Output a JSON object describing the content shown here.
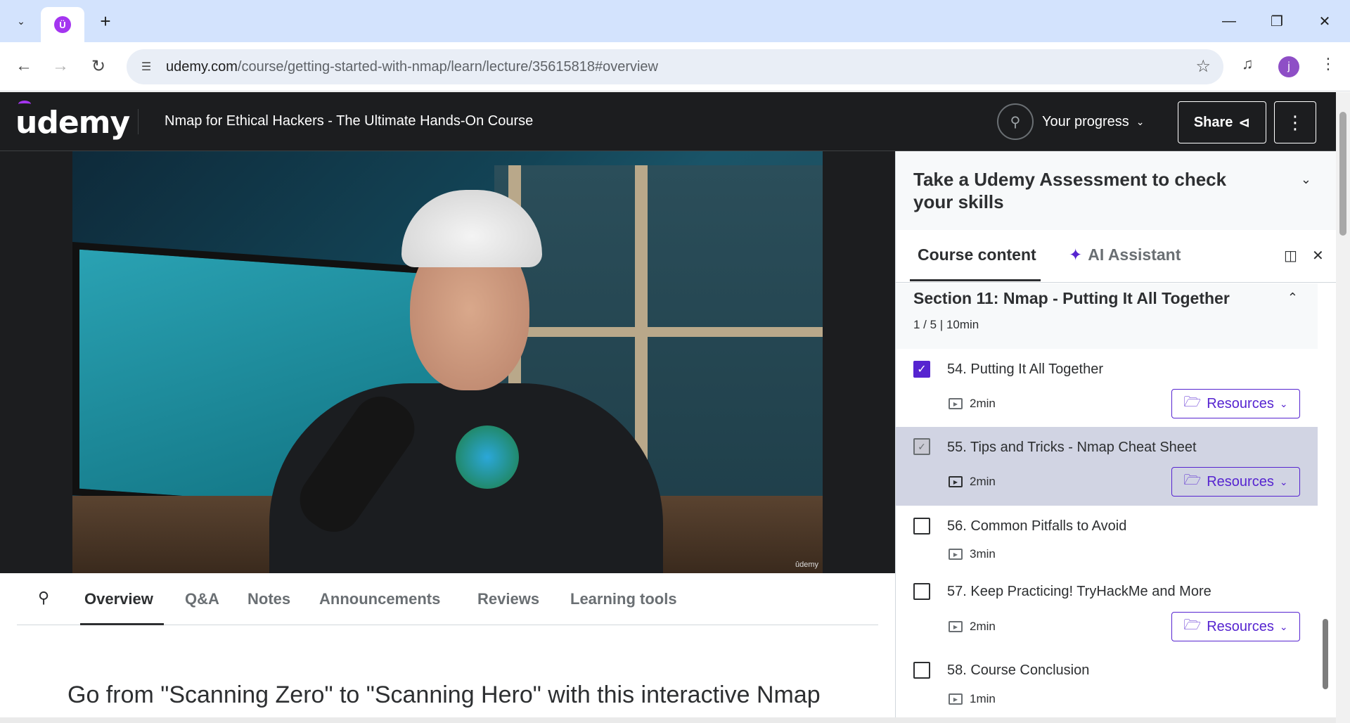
{
  "browser": {
    "url_host": "udemy.com",
    "url_path": "/course/getting-started-with-nmap/learn/lecture/35615818#overview"
  },
  "header": {
    "logo": "udemy",
    "course_title": "Nmap for Ethical Hackers - The Ultimate Hands-On Course",
    "progress_label": "Your progress",
    "share_label": "Share"
  },
  "video": {
    "watermark": "ûdemy"
  },
  "tabs": {
    "items": [
      "Overview",
      "Q&A",
      "Notes",
      "Announcements",
      "Reviews",
      "Learning tools"
    ],
    "active": "Overview"
  },
  "overview": {
    "headline": "Go from \"Scanning Zero\" to \"Scanning Hero\" with this interactive Nmap"
  },
  "sidebar": {
    "assessment": "Take a Udemy Assessment to check your skills",
    "tab_course": "Course content",
    "tab_ai": "AI Assistant",
    "section_title": "Section 11: Nmap - Putting It All Together",
    "section_meta": "1 / 5 | 10min",
    "lectures": [
      {
        "title": "54. Putting It All Together",
        "duration": "2min",
        "done": true,
        "resources": "Resources"
      },
      {
        "title": "55. Tips and Tricks - Nmap Cheat Sheet",
        "duration": "2min",
        "done": false,
        "resources": "Resources"
      },
      {
        "title": "56. Common Pitfalls to Avoid",
        "duration": "3min",
        "done": false
      },
      {
        "title": "57. Keep Practicing! TryHackMe and More",
        "duration": "2min",
        "done": false,
        "resources": "Resources"
      },
      {
        "title": "58. Course Conclusion",
        "duration": "1min",
        "done": false
      }
    ]
  },
  "colors": {
    "accent": "#5624d0",
    "brand": "#a435f0",
    "header_bg": "#1c1d1f",
    "highlight_row": "#d1d4e3"
  }
}
